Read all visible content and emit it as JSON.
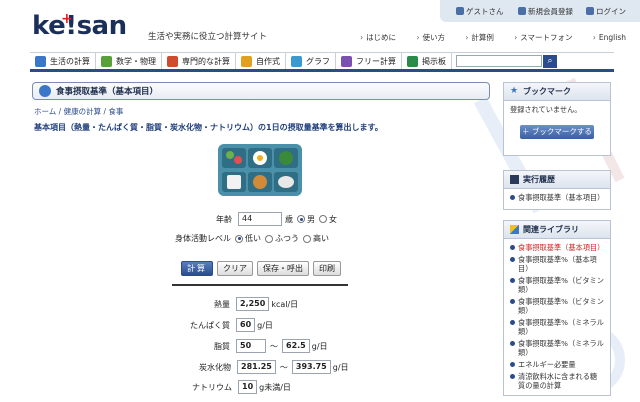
{
  "header": {
    "logo": "ke!san",
    "tagline": "生活や実務に役立つ計算サイト",
    "user": {
      "guest": "ゲストさん",
      "register": "新規会員登録",
      "login": "ログイン"
    },
    "links": [
      "はじめに",
      "使い方",
      "計算例",
      "スマートフォン",
      "English"
    ]
  },
  "nav": {
    "items": [
      {
        "label": "生活の計算",
        "color": "#3a77c8"
      },
      {
        "label": "数学・物理",
        "color": "#5aa03a"
      },
      {
        "label": "専門的な計算",
        "color": "#d04a30"
      },
      {
        "label": "自作式",
        "color": "#e0a020"
      },
      {
        "label": "グラフ",
        "color": "#3a9ad0"
      },
      {
        "label": "フリー計算",
        "color": "#7a50b0"
      },
      {
        "label": "掲示板",
        "color": "#2a8a4a"
      }
    ],
    "search_placeholder": "",
    "search_icon": "search-icon"
  },
  "page": {
    "title": "食事摂取基準（基本項目）",
    "breadcrumb": "ホーム / 健康の計算 / 食事",
    "lead": "基本項目（熱量・たんぱく質・脂質・炭水化物・ナトリウム）の1日の摂取量基準を算出します。"
  },
  "form": {
    "age_label": "年齢",
    "age_value": "44",
    "age_unit": "歳",
    "sex_male": "男",
    "sex_female": "女",
    "activity_label": "身体活動レベル",
    "activity_low": "低い",
    "activity_mid": "ふつう",
    "activity_high": "高い"
  },
  "buttons": {
    "calc": "計算",
    "clear": "クリア",
    "save": "保存・呼出",
    "print": "印刷"
  },
  "results": {
    "energy_label": "熱量",
    "energy_value": "2,250",
    "energy_unit": "kcal/日",
    "protein_label": "たんぱく質",
    "protein_value": "60",
    "protein_unit": "g/日",
    "fat_label": "脂質",
    "fat_min": "50",
    "fat_sep": "〜",
    "fat_max": "62.5",
    "fat_unit": "g/日",
    "carb_label": "炭水化物",
    "carb_min": "281.25",
    "carb_sep": "〜",
    "carb_max": "393.75",
    "carb_unit": "g/日",
    "sodium_label": "ナトリウム",
    "sodium_value": "10",
    "sodium_unit": "g未満/日"
  },
  "sidebar": {
    "bookmark": {
      "title": "ブックマーク",
      "empty": "登録されていません。",
      "button": "＋ ブックマークする"
    },
    "history": {
      "title": "実行履歴",
      "items": [
        "食事摂取基準（基本項目）"
      ]
    },
    "library": {
      "title": "関連ライブラリ",
      "items": [
        "食事摂取基準（基本項目）",
        "食事摂取基準%（基本項目）",
        "食事摂取基準%（ビタミン類）",
        "食事摂取基準%（ビタミン類）",
        "食事摂取基準%（ミネラル類）",
        "食事摂取基準%（ミネラル類）",
        "エネルギー必要量",
        "清涼飲料水に含まれる糖質の量の計算"
      ]
    }
  },
  "colors": {
    "accent": "#2a4c8c",
    "highlight": "#d02020"
  }
}
